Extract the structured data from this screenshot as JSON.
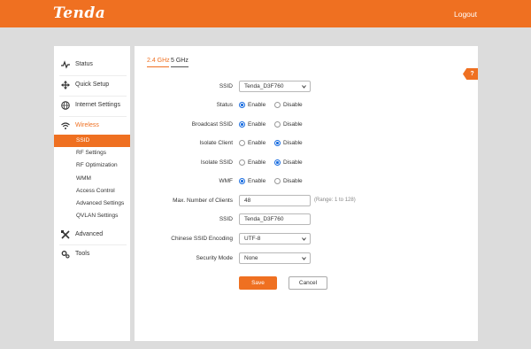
{
  "header": {
    "brand": "Tenda",
    "logout": "Logout"
  },
  "sidebar": {
    "items": [
      {
        "label": "Status",
        "icon": "pulse-icon"
      },
      {
        "label": "Quick Setup",
        "icon": "move-arrows-icon"
      },
      {
        "label": "Internet Settings",
        "icon": "globe-icon"
      },
      {
        "label": "Wireless",
        "icon": "wifi-icon",
        "active": true
      },
      {
        "label": "Advanced",
        "icon": "tools-cross-icon"
      },
      {
        "label": "Tools",
        "icon": "gear-icon"
      }
    ],
    "wireless_sub": [
      {
        "label": "SSID",
        "active": true
      },
      {
        "label": "RF Settings"
      },
      {
        "label": "RF Optimization"
      },
      {
        "label": "WMM"
      },
      {
        "label": "Access Control"
      },
      {
        "label": "Advanced Settings"
      },
      {
        "label": "QVLAN Settings"
      }
    ]
  },
  "tabs": [
    {
      "label": "2.4 GHz",
      "active": true
    },
    {
      "label": "5 GHz",
      "active": false
    }
  ],
  "help": "?",
  "form": {
    "ssid_select": {
      "label": "SSID",
      "value": "Tenda_D3F760"
    },
    "status": {
      "label": "Status",
      "enable": "Enable",
      "disable": "Disable",
      "selected": "enable"
    },
    "broadcast": {
      "label": "Broadcast SSID",
      "enable": "Enable",
      "disable": "Disable",
      "selected": "enable"
    },
    "isolate_client": {
      "label": "Isolate Client",
      "enable": "Enable",
      "disable": "Disable",
      "selected": "disable"
    },
    "isolate_ssid": {
      "label": "Isolate SSID",
      "enable": "Enable",
      "disable": "Disable",
      "selected": "disable"
    },
    "wmf": {
      "label": "WMF",
      "enable": "Enable",
      "disable": "Disable",
      "selected": "enable"
    },
    "max_clients": {
      "label": "Max. Number of Clients",
      "value": "48",
      "range": "(Range: 1 to 128)"
    },
    "ssid_input": {
      "label": "SSID",
      "value": "Tenda_D3F760"
    },
    "encoding": {
      "label": "Chinese SSID Encoding",
      "value": "UTF-8"
    },
    "security": {
      "label": "Security Mode",
      "value": "None"
    },
    "save": "Save",
    "cancel": "Cancel"
  },
  "colors": {
    "brand": "#ef7021",
    "radio": "#1a6de0",
    "background": "#dcdcdc"
  }
}
